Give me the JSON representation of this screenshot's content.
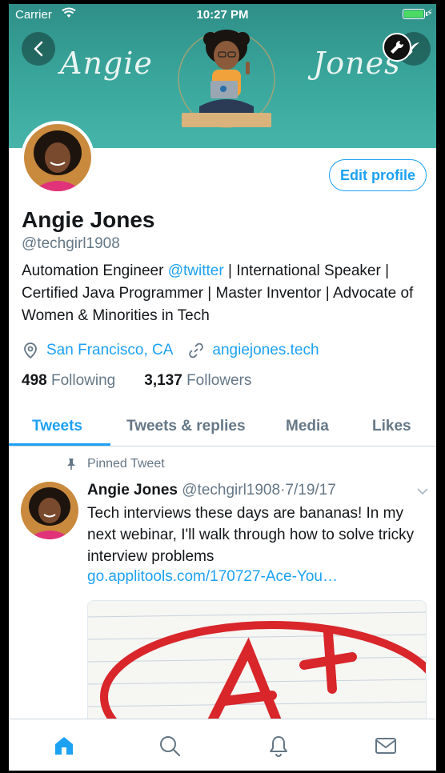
{
  "status_bar": {
    "carrier": "Carrier",
    "time": "10:27 PM"
  },
  "banner": {
    "word_left": "Angie",
    "word_right": "Jones"
  },
  "profile": {
    "edit_label": "Edit profile",
    "name": "Angie Jones",
    "handle": "@techgirl1908",
    "bio_before": "Automation Engineer ",
    "bio_mention": "@twitter",
    "bio_after": " | International Speaker | Certified Java Programmer | Master Inventor | Advocate of Women & Minorities in Tech",
    "location": "San Francisco, CA",
    "website": "angiejones.tech",
    "following_count": "498",
    "following_label": "Following",
    "followers_count": "3,137",
    "followers_label": "Followers"
  },
  "tabs": [
    {
      "label": "Tweets"
    },
    {
      "label": "Tweets & replies"
    },
    {
      "label": "Media"
    },
    {
      "label": "Likes"
    }
  ],
  "tweet": {
    "pinned_label": "Pinned Tweet",
    "author": "Angie Jones",
    "handle": "@techgirl1908",
    "separator": "·",
    "date": "7/19/17",
    "text": "Tech interviews these days are bananas! In my next webinar, I'll walk through how to solve tricky interview problems",
    "link": "go.applitools.com/170727-Ace-You…"
  },
  "icons": {
    "back": "chevron-left-icon",
    "tools": "wrench-icon",
    "compose": "feather-icon",
    "location": "map-pin-icon",
    "link": "link-icon",
    "pin": "pin-icon",
    "home": "home-icon",
    "search": "search-icon",
    "notifications": "bell-icon",
    "messages": "mail-icon"
  },
  "colors": {
    "accent": "#1da1f2",
    "banner": "#3aa79d",
    "muted": "#657786"
  }
}
